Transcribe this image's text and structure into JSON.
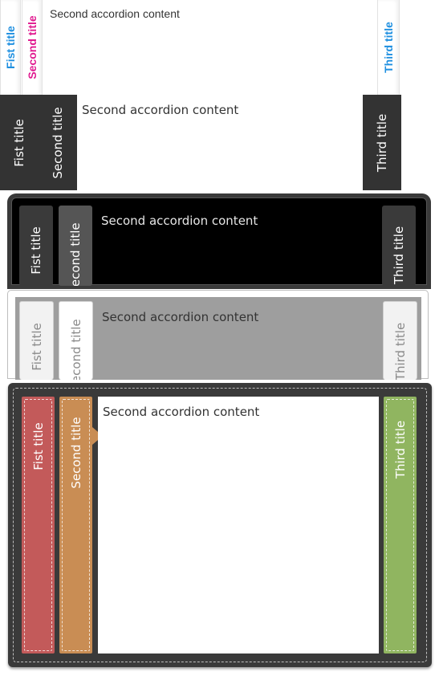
{
  "colors": {
    "v1_first": "#1e8fe0",
    "v1_second": "#e0198f",
    "v1_third": "#1e8fe0",
    "v5_first": "#c35a5a",
    "v5_second": "#c98d54",
    "v5_third": "#90b560"
  },
  "accordions": [
    {
      "tabs": {
        "first": "Fist title",
        "second": "Second title",
        "third": "Third title"
      },
      "content": "Second accordion content"
    },
    {
      "tabs": {
        "first": "Fist title",
        "second": "Second title",
        "third": "Third title"
      },
      "content": "Second accordion content"
    },
    {
      "tabs": {
        "first": "Fist title",
        "second": "Second title",
        "third": "Third title"
      },
      "content": "Second accordion content"
    },
    {
      "tabs": {
        "first": "Fist title",
        "second": "Second title",
        "third": "Third title"
      },
      "content": "Second accordion content"
    },
    {
      "tabs": {
        "first": "Fist title",
        "second": "Second title",
        "third": "Third title"
      },
      "content": "Second accordion content"
    }
  ]
}
